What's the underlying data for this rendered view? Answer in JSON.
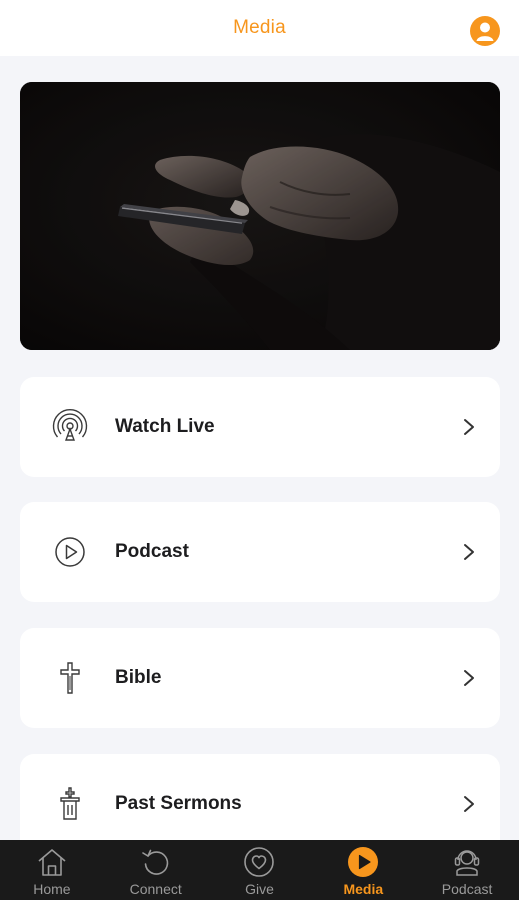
{
  "header": {
    "title": "Media",
    "profile_icon": "person-icon"
  },
  "hero": {
    "image": "hands-holding-phone-photo"
  },
  "menu": [
    {
      "label": "Watch Live",
      "icon": "broadcast-icon"
    },
    {
      "label": "Podcast",
      "icon": "play-circle-icon"
    },
    {
      "label": "Bible",
      "icon": "cross-icon"
    },
    {
      "label": "Past Sermons",
      "icon": "pulpit-icon"
    }
  ],
  "tabbar": {
    "tabs": [
      {
        "label": "Home",
        "icon": "home-icon"
      },
      {
        "label": "Connect",
        "icon": "refresh-icon"
      },
      {
        "label": "Give",
        "icon": "heart-icon"
      },
      {
        "label": "Media",
        "icon": "play-icon"
      },
      {
        "label": "Podcast",
        "icon": "headset-icon"
      }
    ],
    "active_tab": "Media"
  },
  "colors": {
    "accent": "#f7961d",
    "background": "#f4f5f9",
    "tabbar": "#1a1a1a",
    "card": "#ffffff"
  }
}
